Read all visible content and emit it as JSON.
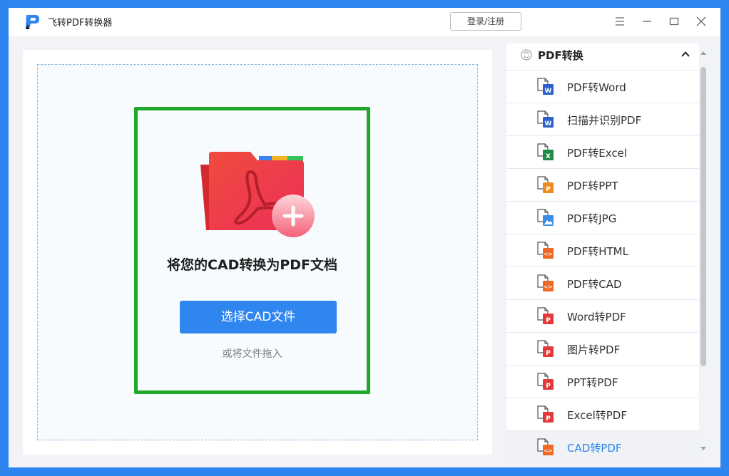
{
  "app": {
    "title": "飞转PDF转换器",
    "login_label": "登录/注册"
  },
  "colors": {
    "frame": "#2d86f0",
    "accent": "#2f86ef",
    "highlight": "#1fa82a",
    "folder": "#ea3a46"
  },
  "main": {
    "drop_title": "将您的CAD转换为PDF文档",
    "select_label": "选择CAD文件",
    "drop_hint": "或将文件拖入"
  },
  "sidebar": {
    "section_label": "PDF转换",
    "items": [
      {
        "label": "PDF转Word",
        "icon": "word-doc-icon",
        "badge_color": "#2b5fc9",
        "badge": "W"
      },
      {
        "label": "扫描并识别PDF",
        "icon": "word-doc-icon",
        "badge_color": "#2b5fc9",
        "badge": "W"
      },
      {
        "label": "PDF转Excel",
        "icon": "excel-doc-icon",
        "badge_color": "#1e8a46",
        "badge": "X"
      },
      {
        "label": "PDF转PPT",
        "icon": "ppt-doc-icon",
        "badge_color": "#ee8a1e",
        "badge": "P"
      },
      {
        "label": "PDF转JPG",
        "icon": "image-doc-icon",
        "badge_color": "#3a8de6",
        "badge": ""
      },
      {
        "label": "PDF转HTML",
        "icon": "code-doc-icon",
        "badge_color": "#ee6a24",
        "badge": "</>"
      },
      {
        "label": "PDF转CAD",
        "icon": "code-doc-icon",
        "badge_color": "#ee6a24",
        "badge": "</>"
      },
      {
        "label": "Word转PDF",
        "icon": "pdf-doc-icon",
        "badge_color": "#e23a3a",
        "badge": "P"
      },
      {
        "label": "图片转PDF",
        "icon": "pdf-doc-icon",
        "badge_color": "#e23a3a",
        "badge": "P"
      },
      {
        "label": "PPT转PDF",
        "icon": "pdf-doc-icon",
        "badge_color": "#e23a3a",
        "badge": "P"
      },
      {
        "label": "Excel转PDF",
        "icon": "pdf-doc-icon",
        "badge_color": "#e23a3a",
        "badge": "P"
      },
      {
        "label": "CAD转PDF",
        "icon": "code-doc-icon",
        "badge_color": "#ee6a24",
        "badge": "</>",
        "active": true
      }
    ]
  }
}
